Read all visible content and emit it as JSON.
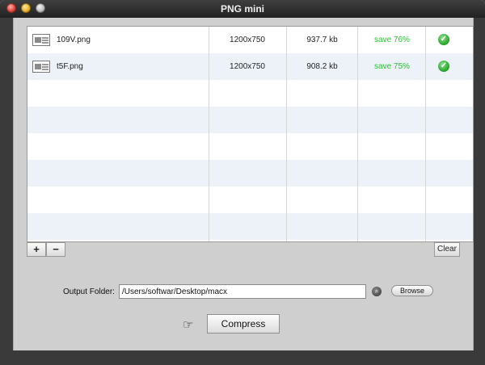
{
  "window": {
    "title": "PNG mini"
  },
  "files": [
    {
      "name": "109V.png",
      "resolution": "1200x750",
      "size": "937.7 kb",
      "saving": "save 76%",
      "status_icon": "check-circle-icon"
    },
    {
      "name": "t5F.png",
      "resolution": "1200x750",
      "size": "908.2 kb",
      "saving": "save 75%",
      "status_icon": "check-circle-icon"
    }
  ],
  "list_controls": {
    "add_label": "+",
    "remove_label": "−",
    "clear_label": "Clear"
  },
  "output": {
    "label": "Output Folder:",
    "path": "/Users/softwar/Desktop/macx",
    "browse_label": "Browse"
  },
  "actions": {
    "compress_label": "Compress",
    "pointer_icon": "hand-pointer-icon"
  },
  "colors": {
    "saving_text": "#22c42a",
    "status_ok": "#2aa82a",
    "row_alt": "#edf2f9"
  }
}
